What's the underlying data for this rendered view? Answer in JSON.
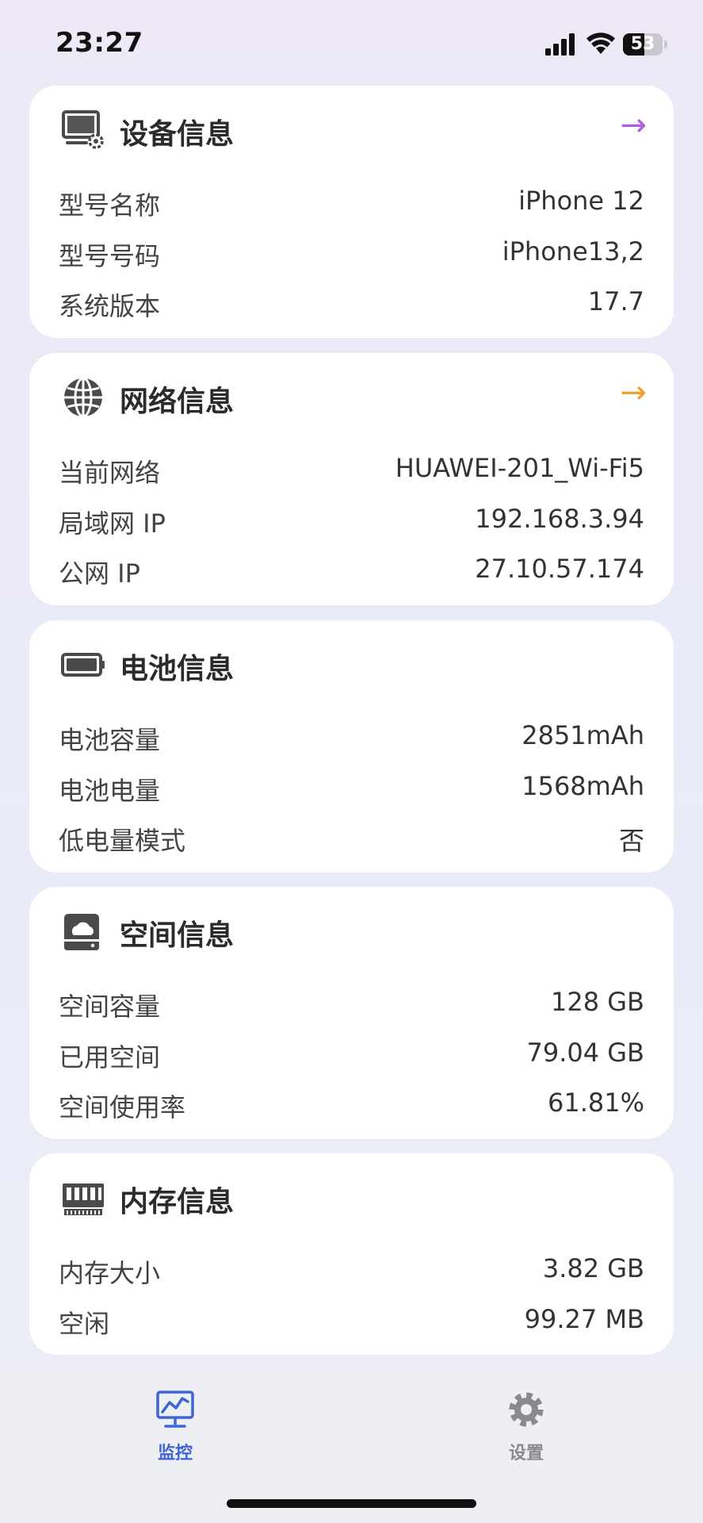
{
  "status_bar": {
    "time": "23:27",
    "battery_level": "53",
    "battery_fraction": 0.53
  },
  "cards": {
    "device": {
      "title": "设备信息",
      "icon": "monitor-gear-icon",
      "arrow": "→",
      "arrow_color": "#b05ee0",
      "rows": [
        {
          "label": "型号名称",
          "value": "iPhone 12"
        },
        {
          "label": "型号号码",
          "value": "iPhone13,2"
        },
        {
          "label": "系统版本",
          "value": "17.7"
        }
      ]
    },
    "network": {
      "title": "网络信息",
      "icon": "globe-icon",
      "arrow": "→",
      "arrow_color": "#f2a02c",
      "rows": [
        {
          "label": "当前网络",
          "value": "HUAWEI-201_Wi-Fi5"
        },
        {
          "label": "局域网 IP",
          "value": "192.168.3.94"
        },
        {
          "label": "公网 IP",
          "value": "27.10.57.174"
        }
      ]
    },
    "battery": {
      "title": "电池信息",
      "icon": "battery-icon",
      "rows": [
        {
          "label": "电池容量",
          "value": "2851mAh"
        },
        {
          "label": "电池电量",
          "value": "1568mAh"
        },
        {
          "label": "低电量模式",
          "value": "否"
        }
      ]
    },
    "storage": {
      "title": "空间信息",
      "icon": "storage-drive-icon",
      "rows": [
        {
          "label": "空间容量",
          "value": "128 GB"
        },
        {
          "label": "已用空间",
          "value": "79.04 GB"
        },
        {
          "label": "空间使用率",
          "value": "61.81%"
        }
      ]
    },
    "memory": {
      "title": "内存信息",
      "icon": "memory-chip-icon",
      "rows": [
        {
          "label": "内存大小",
          "value": "3.82 GB"
        },
        {
          "label": "空闲",
          "value": "99.27 MB"
        }
      ]
    }
  },
  "tab_bar": {
    "items": [
      {
        "label": "监控",
        "icon": "monitor-chart-icon",
        "active": true,
        "color": "#3f63d9"
      },
      {
        "label": "设置",
        "icon": "gear-icon",
        "active": false,
        "color": "#8a8a8e"
      }
    ]
  }
}
